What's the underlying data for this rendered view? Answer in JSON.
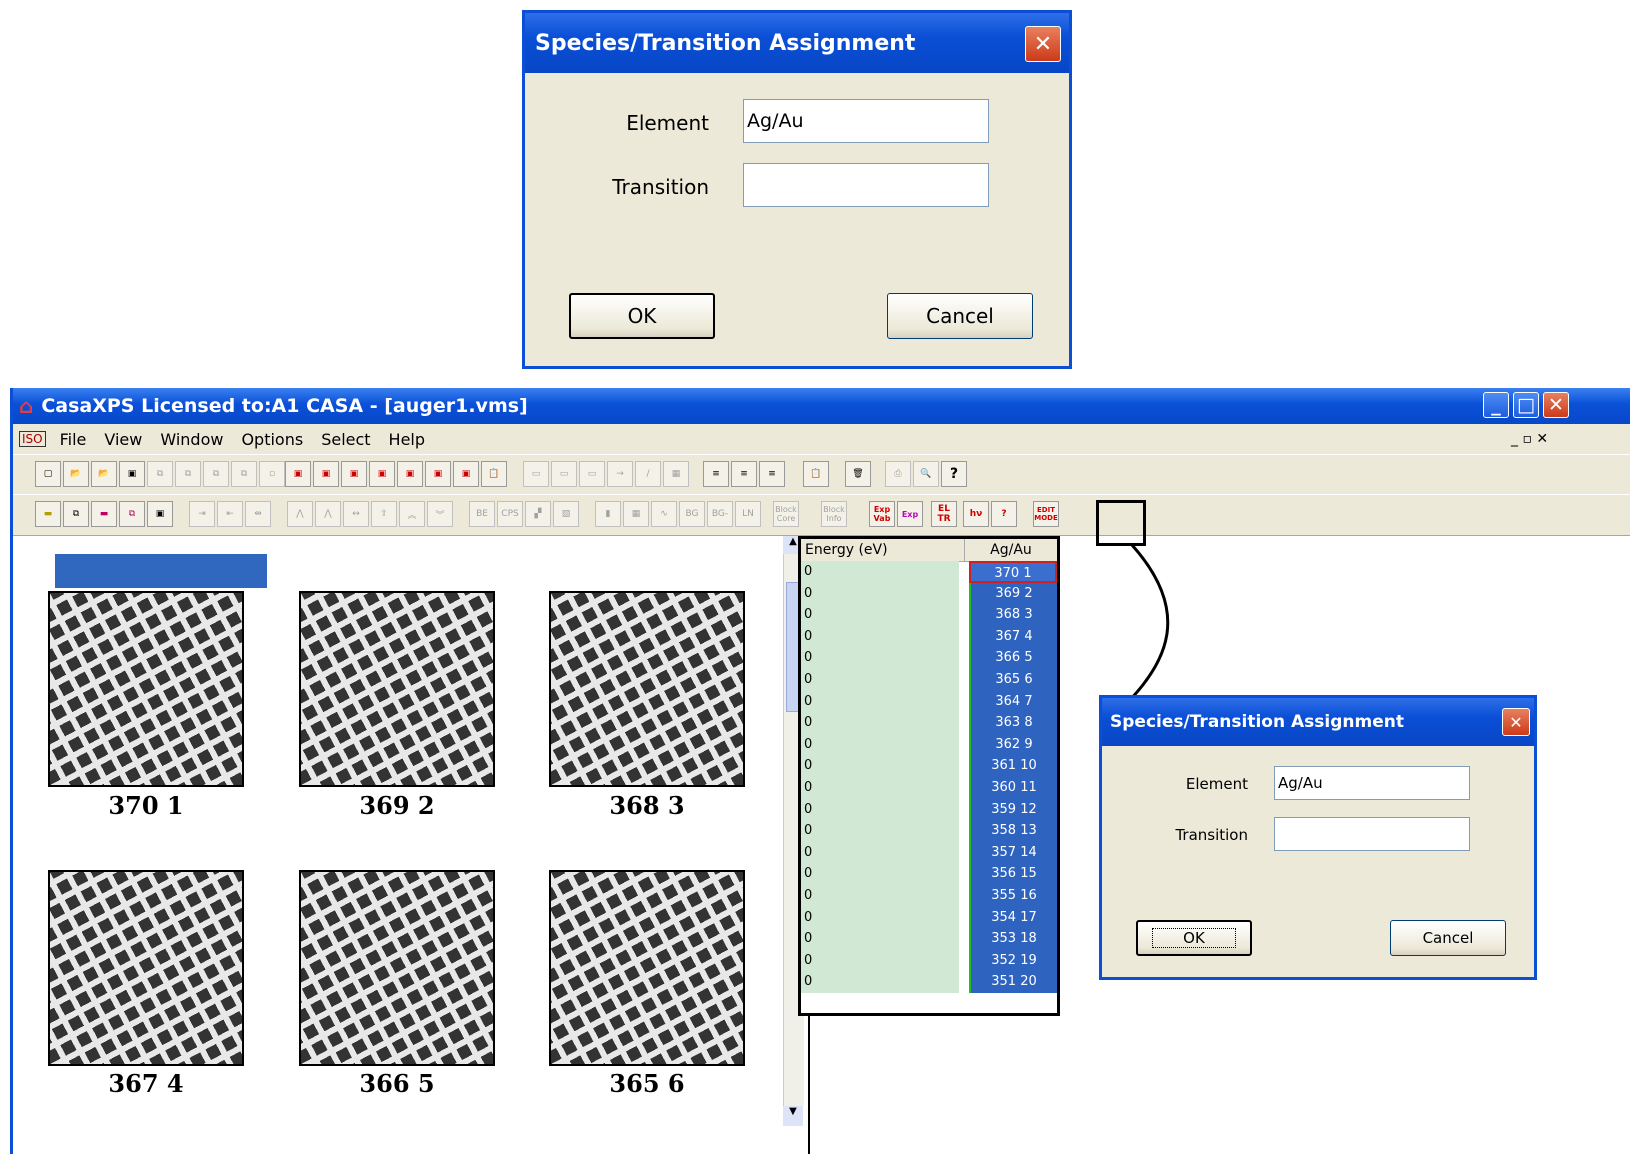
{
  "dialog_top": {
    "title": "Species/Transition Assignment",
    "element_label": "Element",
    "element_value": "Ag/Au",
    "transition_label": "Transition",
    "transition_value": "",
    "ok_label": "OK",
    "cancel_label": "Cancel"
  },
  "app": {
    "title": "CasaXPS Licensed to:A1 CASA - [auger1.vms]",
    "menu": [
      "File",
      "View",
      "Window",
      "Options",
      "Select",
      "Help"
    ]
  },
  "toolbar2_labels": {
    "block_core": "Block Core",
    "block_info": "Block Info",
    "exp_vab": "Exp Vab",
    "el_tr": "EL TR",
    "edit_mode": "EDIT MODE"
  },
  "thumbnails": [
    "370 1",
    "369 2",
    "368 3",
    "367 4",
    "366 5",
    "365 6"
  ],
  "grid": {
    "col1": "Energy (eV)",
    "col2": "Ag/Au",
    "rows": [
      {
        "energy": "0",
        "label": "370 1"
      },
      {
        "energy": "0",
        "label": "369 2"
      },
      {
        "energy": "0",
        "label": "368 3"
      },
      {
        "energy": "0",
        "label": "367 4"
      },
      {
        "energy": "0",
        "label": "366 5"
      },
      {
        "energy": "0",
        "label": "365 6"
      },
      {
        "energy": "0",
        "label": "364 7"
      },
      {
        "energy": "0",
        "label": "363 8"
      },
      {
        "energy": "0",
        "label": "362 9"
      },
      {
        "energy": "0",
        "label": "361 10"
      },
      {
        "energy": "0",
        "label": "360 11"
      },
      {
        "energy": "0",
        "label": "359 12"
      },
      {
        "energy": "0",
        "label": "358 13"
      },
      {
        "energy": "0",
        "label": "357 14"
      },
      {
        "energy": "0",
        "label": "356 15"
      },
      {
        "energy": "0",
        "label": "355 16"
      },
      {
        "energy": "0",
        "label": "354 17"
      },
      {
        "energy": "0",
        "label": "353 18"
      },
      {
        "energy": "0",
        "label": "352 19"
      },
      {
        "energy": "0",
        "label": "351 20"
      }
    ]
  },
  "dialog_small": {
    "title": "Species/Transition Assignment",
    "element_label": "Element",
    "element_value": "Ag/Au",
    "transition_label": "Transition",
    "transition_value": "",
    "ok_label": "OK",
    "cancel_label": "Cancel"
  }
}
